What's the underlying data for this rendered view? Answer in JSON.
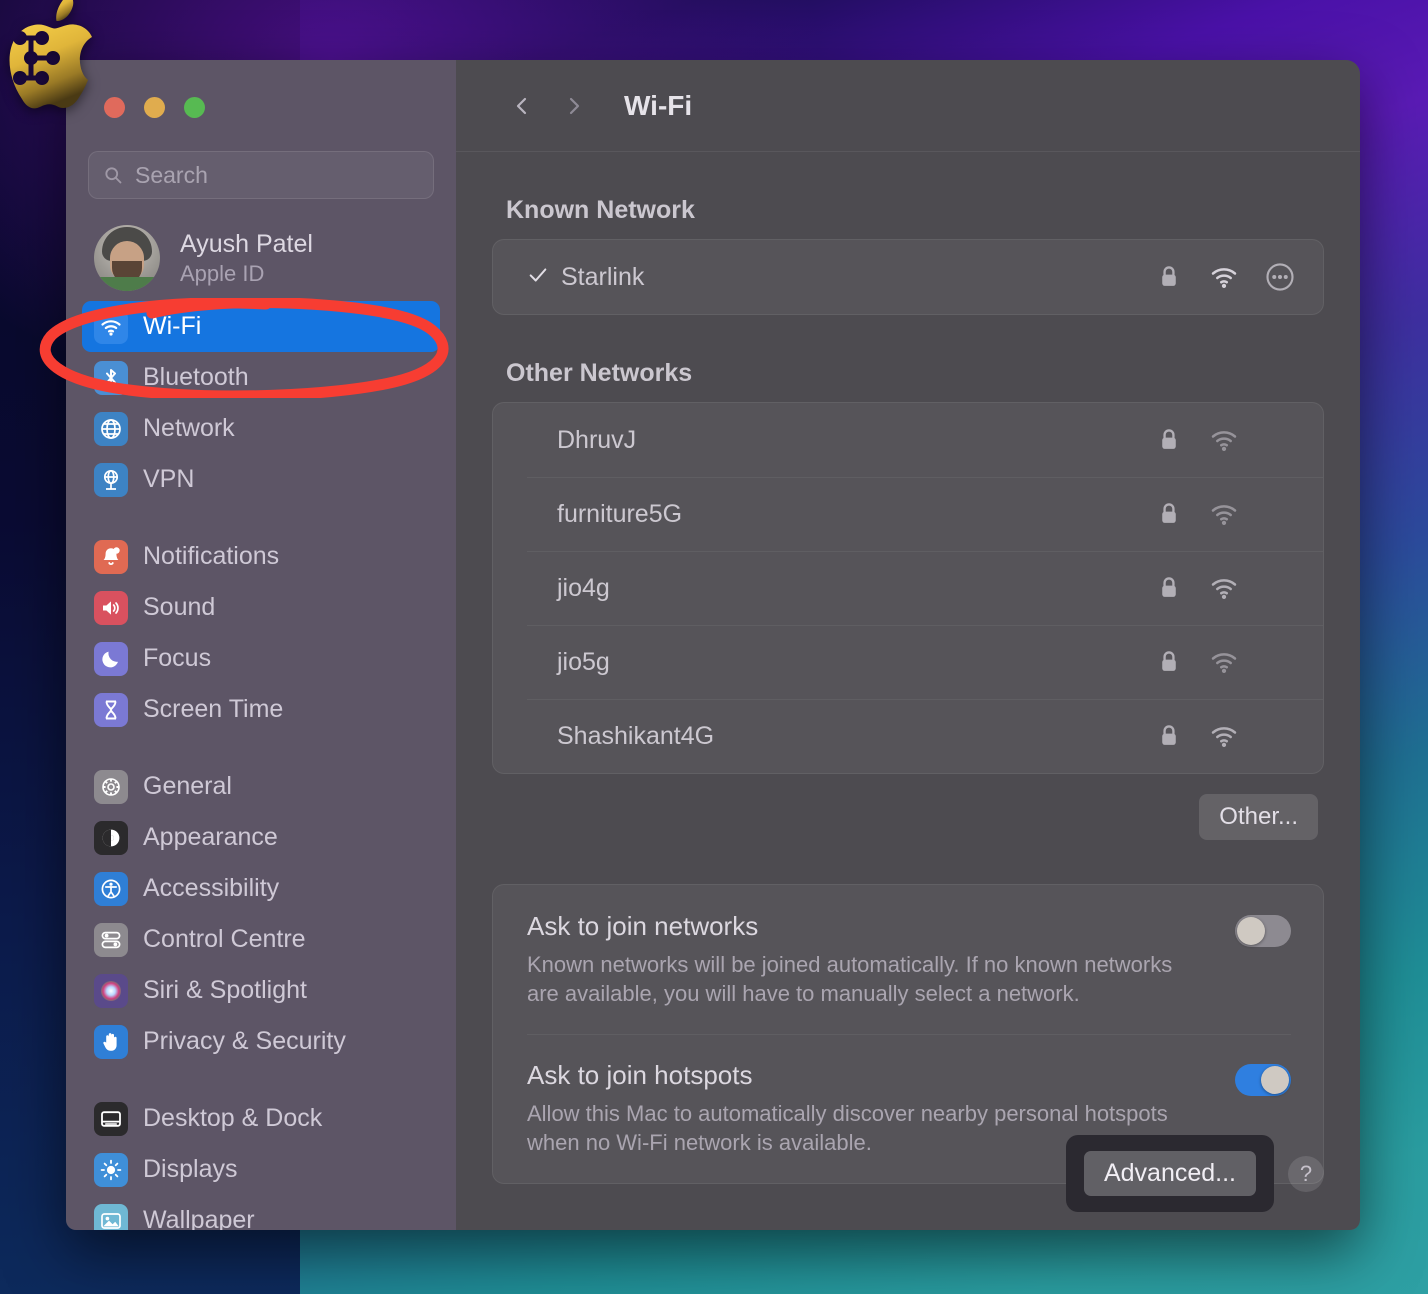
{
  "window": {
    "title": "Wi-Fi",
    "traffic_lights": [
      "close",
      "minimize",
      "zoom"
    ],
    "accent_selected": "#1575e0"
  },
  "sidebar": {
    "search": {
      "placeholder": "Search",
      "value": ""
    },
    "account": {
      "name": "Ayush Patel",
      "subtitle": "Apple ID"
    },
    "groups": [
      {
        "items": [
          {
            "label": "Wi-Fi",
            "icon": "wifi-icon",
            "selected": true,
            "color": "#2f86e8"
          },
          {
            "label": "Bluetooth",
            "icon": "bluetooth-icon",
            "selected": false,
            "color": "#4a8fd4"
          },
          {
            "label": "Network",
            "icon": "globe-icon",
            "selected": false,
            "color": "#3d83c4"
          },
          {
            "label": "VPN",
            "icon": "vpn-globe-icon",
            "selected": false,
            "color": "#3d83c4"
          }
        ]
      },
      {
        "items": [
          {
            "label": "Notifications",
            "icon": "bell-icon",
            "selected": false,
            "color": "#e06a53"
          },
          {
            "label": "Sound",
            "icon": "speaker-icon",
            "selected": false,
            "color": "#d9515f"
          },
          {
            "label": "Focus",
            "icon": "moon-icon",
            "selected": false,
            "color": "#7b79d4"
          },
          {
            "label": "Screen Time",
            "icon": "hourglass-icon",
            "selected": false,
            "color": "#7b79d4"
          }
        ]
      },
      {
        "items": [
          {
            "label": "General",
            "icon": "gear-icon",
            "selected": false,
            "color": "#8d8a8f"
          },
          {
            "label": "Appearance",
            "icon": "appearance-icon",
            "selected": false,
            "color": "#2b2a2c"
          },
          {
            "label": "Accessibility",
            "icon": "accessibility-icon",
            "selected": false,
            "color": "#2f7fd6"
          },
          {
            "label": "Control Centre",
            "icon": "control-centre-icon",
            "selected": false,
            "color": "#8d8a8f"
          },
          {
            "label": "Siri & Spotlight",
            "icon": "siri-icon",
            "selected": false,
            "color": "#5a4a8a"
          },
          {
            "label": "Privacy & Security",
            "icon": "hand-icon",
            "selected": false,
            "color": "#2f7fd6"
          }
        ]
      },
      {
        "items": [
          {
            "label": "Desktop & Dock",
            "icon": "desktop-dock-icon",
            "selected": false,
            "color": "#2b2a2c"
          },
          {
            "label": "Displays",
            "icon": "brightness-icon",
            "selected": false,
            "color": "#3f8fd8"
          },
          {
            "label": "Wallpaper",
            "icon": "wallpaper-icon",
            "selected": false,
            "color": "#6fb8d4"
          }
        ]
      }
    ]
  },
  "main": {
    "nav": {
      "back": "back-chevron",
      "forward": "forward-chevron"
    },
    "known_network": {
      "heading": "Known Network",
      "rows": [
        {
          "name": "Starlink",
          "connected": true,
          "secured": true,
          "signal": "strong",
          "has_more": true
        }
      ]
    },
    "other_networks": {
      "heading": "Other Networks",
      "rows": [
        {
          "name": "DhruvJ",
          "secured": true,
          "signal": "weak"
        },
        {
          "name": "furniture5G",
          "secured": true,
          "signal": "weak"
        },
        {
          "name": "jio4g",
          "secured": true,
          "signal": "medium"
        },
        {
          "name": "jio5g",
          "secured": true,
          "signal": "weak"
        },
        {
          "name": "Shashikant4G",
          "secured": true,
          "signal": "medium"
        }
      ],
      "other_button": "Other..."
    },
    "preferences": [
      {
        "title": "Ask to join networks",
        "description": "Known networks will be joined automatically. If no known networks are available, you will have to manually select a network.",
        "enabled": false
      },
      {
        "title": "Ask to join hotspots",
        "description": "Allow this Mac to automatically discover nearby personal hotspots when no Wi-Fi network is available.",
        "enabled": true
      }
    ],
    "footer": {
      "advanced_label": "Advanced...",
      "help_label": "?"
    }
  },
  "annotation": {
    "shape": "red-ellipse",
    "color": "#f73d32",
    "targets": "Wi-Fi"
  }
}
